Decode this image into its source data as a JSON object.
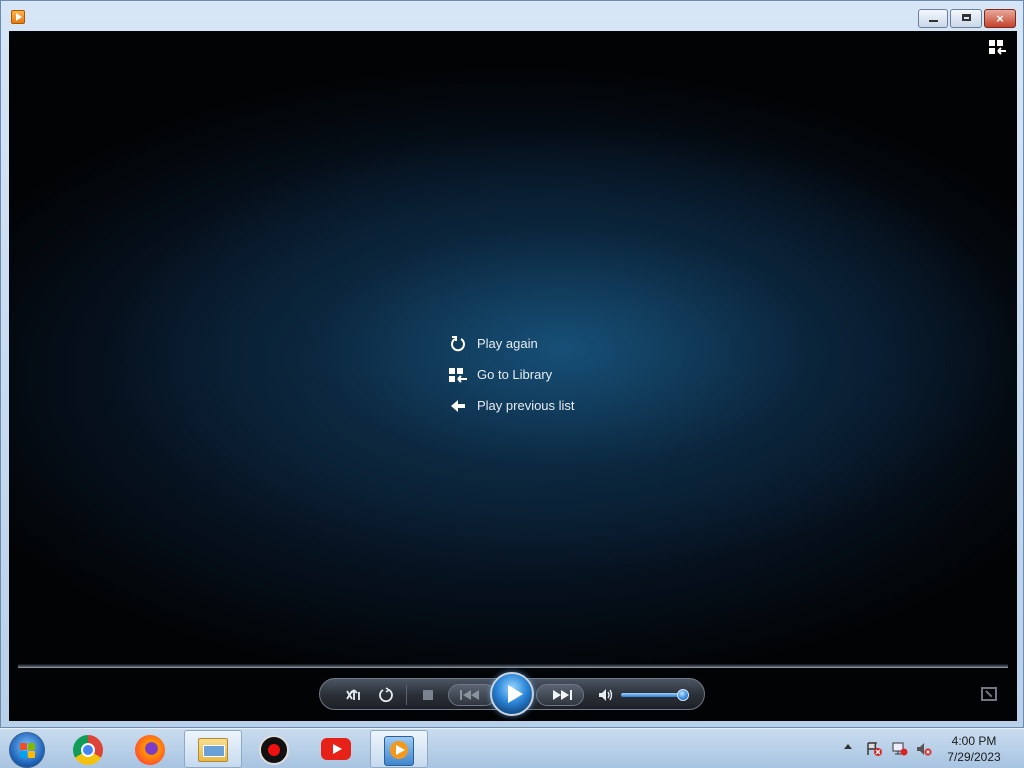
{
  "window": {
    "title": "",
    "app_icon": "windows-media-player-icon",
    "buttons": {
      "minimize": "minimize-icon",
      "maximize": "restore-icon",
      "close": "×"
    }
  },
  "player": {
    "switch_to_library_icon": "switch-to-library-icon",
    "menu": [
      {
        "icon": "replay-icon",
        "label": "Play again"
      },
      {
        "icon": "library-icon",
        "label": "Go to Library"
      },
      {
        "icon": "back-arrow-icon",
        "label": "Play previous list"
      }
    ],
    "controls": {
      "shuffle": "shuffle-icon",
      "repeat": "repeat-icon",
      "stop": "stop-icon",
      "previous": "previous-icon",
      "play": "play-icon",
      "next": "next-icon",
      "mute": "speaker-icon",
      "volume_level": 0.95,
      "fullscreen": "fullscreen-icon"
    }
  },
  "taskbar": {
    "apps": [
      {
        "name": "chrome",
        "icon": "chrome-icon"
      },
      {
        "name": "firefox",
        "icon": "firefox-icon"
      },
      {
        "name": "file-explorer",
        "icon": "file-explorer-icon"
      },
      {
        "name": "screen-recorder",
        "icon": "record-icon"
      },
      {
        "name": "youtube",
        "icon": "youtube-icon"
      },
      {
        "name": "windows-media-player",
        "icon": "windows-media-player-icon",
        "active": true
      }
    ],
    "tray_icons": [
      "action-center-flag-icon",
      "network-icon",
      "volume-muted-icon"
    ],
    "time": "4:00 PM",
    "date": "7/29/2023"
  },
  "colors": {
    "accent": "#2c86d8",
    "video_bg": "#071423",
    "taskbar": "#b9d0ea"
  }
}
